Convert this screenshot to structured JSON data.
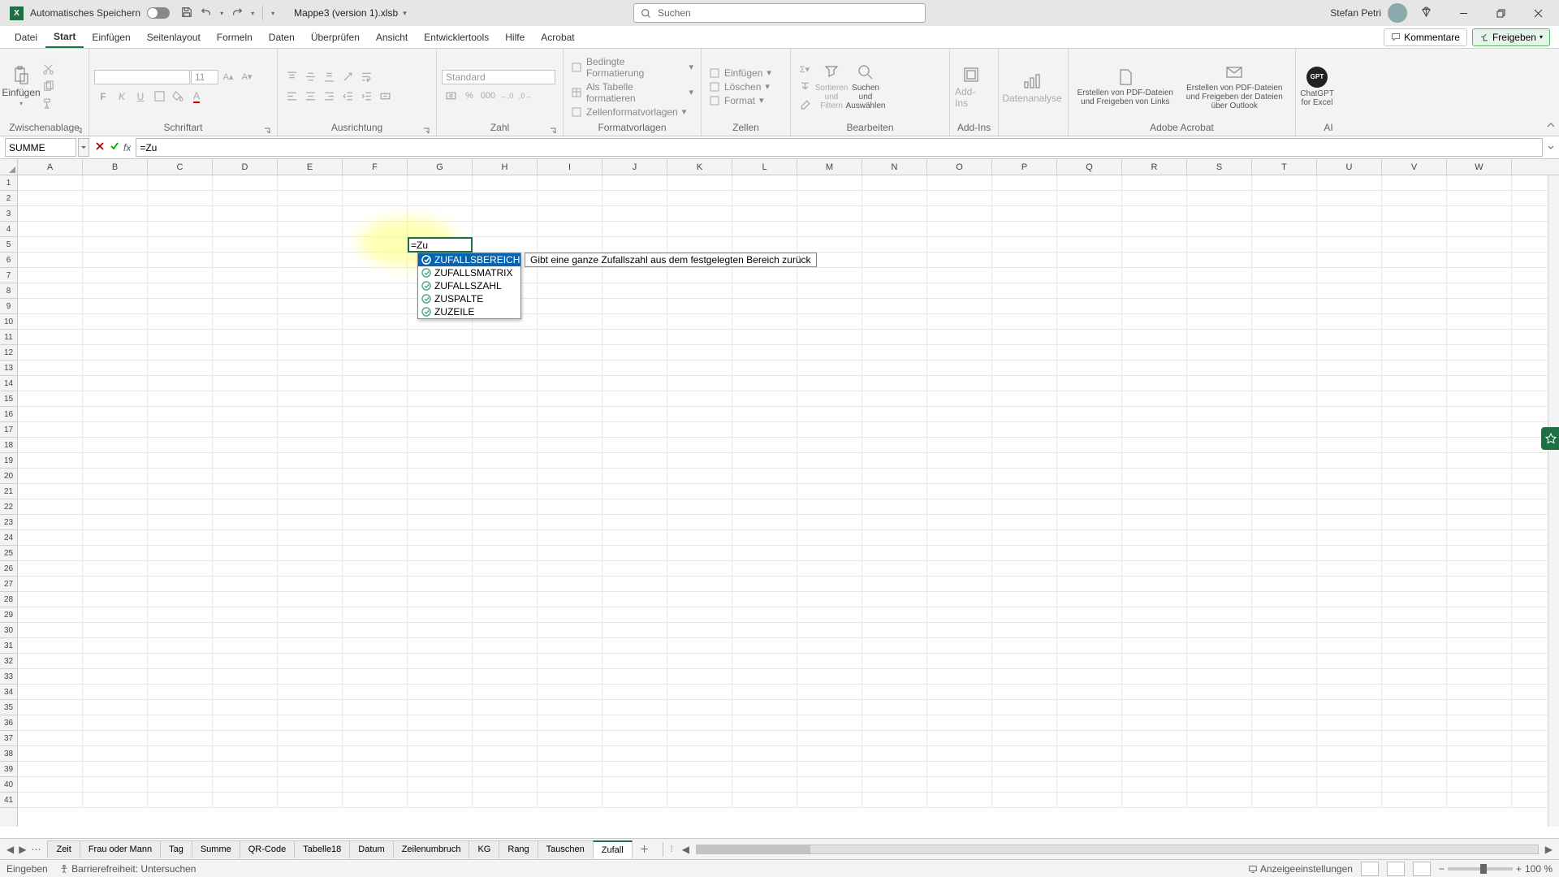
{
  "title": {
    "autosave_label": "Automatisches Speichern",
    "filename": "Mappe3 (version 1).xlsb",
    "search_placeholder": "Suchen",
    "user": "Stefan Petri"
  },
  "menu": {
    "tabs": [
      "Datei",
      "Start",
      "Einfügen",
      "Seitenlayout",
      "Formeln",
      "Daten",
      "Überprüfen",
      "Ansicht",
      "Entwicklertools",
      "Hilfe",
      "Acrobat"
    ],
    "active": 1,
    "comments": "Kommentare",
    "share": "Freigeben"
  },
  "ribbon": {
    "clip": {
      "paste": "Einfügen",
      "label": "Zwischenablage"
    },
    "font": {
      "name": "",
      "size": "11",
      "label": "Schriftart"
    },
    "align": {
      "label": "Ausrichtung"
    },
    "num": {
      "format": "Standard",
      "label": "Zahl"
    },
    "styles": {
      "a": "Bedingte Formatierung",
      "b": "Als Tabelle formatieren",
      "c": "Zellenformatvorlagen",
      "label": "Formatvorlagen"
    },
    "cells": {
      "a": "Einfügen",
      "b": "Löschen",
      "c": "Format",
      "label": "Zellen"
    },
    "edit": {
      "sort": "Sortieren und Filtern",
      "find": "Suchen und Auswählen",
      "label": "Bearbeiten"
    },
    "addins": {
      "a": "Add-Ins",
      "data": "Datenanalyse",
      "label": "Add-Ins"
    },
    "acro": {
      "a": "Erstellen von PDF-Dateien und Freigeben von Links",
      "b": "Erstellen von PDF-Dateien und Freigeben der Dateien über Outlook",
      "label": "Adobe Acrobat"
    },
    "ai": {
      "a": "ChatGPT for Excel",
      "label": "AI"
    }
  },
  "fbar": {
    "name": "SUMME",
    "formula": "=Zu"
  },
  "grid": {
    "cols": [
      "A",
      "B",
      "C",
      "D",
      "E",
      "F",
      "G",
      "H",
      "I",
      "J",
      "K",
      "L",
      "M",
      "N",
      "O",
      "P",
      "Q",
      "R",
      "S",
      "T",
      "U",
      "V",
      "W"
    ],
    "active_cell_value": "=Zu",
    "tooltip": "Gibt eine ganze Zufallszahl aus dem festgelegten Bereich zurück",
    "suggest": [
      "ZUFALLSBEREICH",
      "ZUFALLSMATRIX",
      "ZUFALLSZAHL",
      "ZUSPALTE",
      "ZUZEILE"
    ]
  },
  "sheets": {
    "tabs": [
      "Zeit",
      "Frau oder Mann",
      "Tag",
      "Summe",
      "QR-Code",
      "Tabelle18",
      "Datum",
      "Zeilenumbruch",
      "KG",
      "Rang",
      "Tauschen",
      "Zufall"
    ],
    "active": 11
  },
  "status": {
    "mode": "Eingeben",
    "acc": "Barrierefreiheit: Untersuchen",
    "disp": "Anzeigeeinstellungen",
    "zoom": "100 %"
  }
}
